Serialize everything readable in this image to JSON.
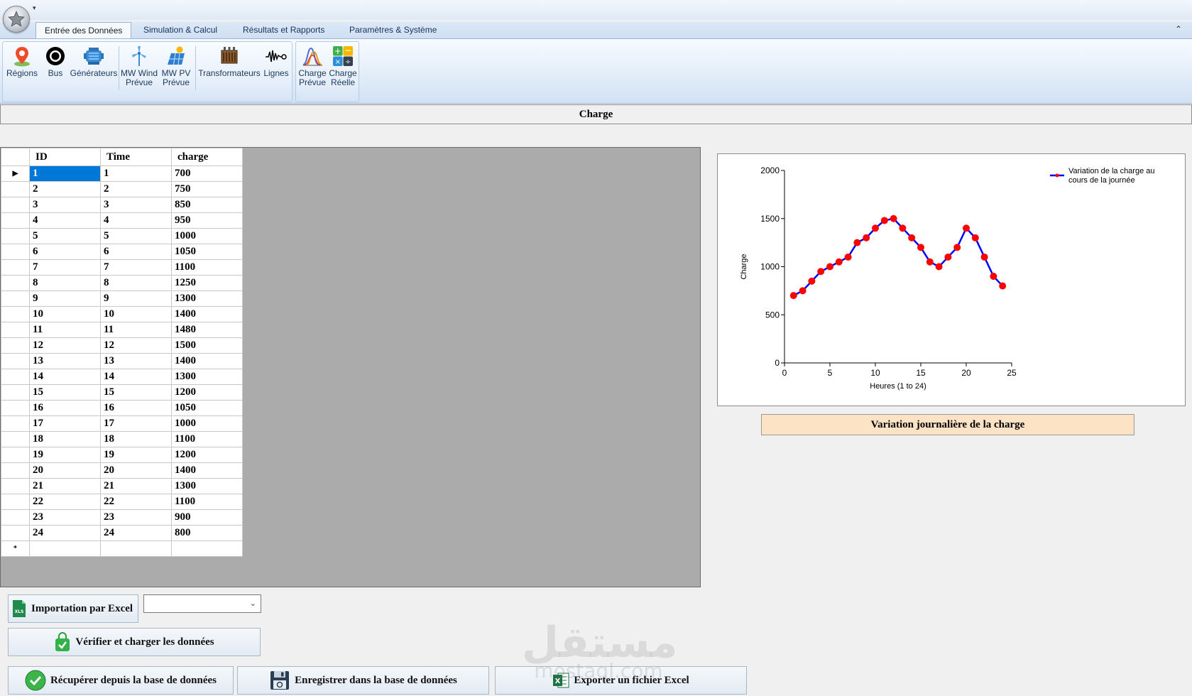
{
  "ribbon": {
    "tabs": [
      {
        "label": "Entrée des Données"
      },
      {
        "label": "Simulation & Calcul"
      },
      {
        "label": "Résultats et Rapports"
      },
      {
        "label": "Paramètres & Système"
      }
    ],
    "buttons": [
      {
        "line1": "Régions",
        "line2": "",
        "icon": "map-pin-icon"
      },
      {
        "line1": "Bus",
        "line2": "",
        "icon": "bus-ring-icon"
      },
      {
        "line1": "Générateurs",
        "line2": "",
        "icon": "generator-icon"
      },
      {
        "line1": "MW Wind",
        "line2": "Prévue",
        "icon": "wind-turbine-icon"
      },
      {
        "line1": "MW PV",
        "line2": "Prévue",
        "icon": "solar-panel-icon"
      },
      {
        "line1": "Transformateurs",
        "line2": "",
        "icon": "transformer-icon"
      },
      {
        "line1": "Lignes",
        "line2": "",
        "icon": "line-wave-icon"
      },
      {
        "line1": "Charge",
        "line2": "Prévue",
        "icon": "load-curve-icon"
      },
      {
        "line1": "Charge",
        "line2": "Réelle",
        "icon": "calculator-icon"
      }
    ]
  },
  "section": {
    "title": "Charge"
  },
  "grid": {
    "columns": [
      "ID",
      "Time",
      "charge"
    ],
    "rows": [
      [
        "1",
        "1",
        "700"
      ],
      [
        "2",
        "2",
        "750"
      ],
      [
        "3",
        "3",
        "850"
      ],
      [
        "4",
        "4",
        "950"
      ],
      [
        "5",
        "5",
        "1000"
      ],
      [
        "6",
        "6",
        "1050"
      ],
      [
        "7",
        "7",
        "1100"
      ],
      [
        "8",
        "8",
        "1250"
      ],
      [
        "9",
        "9",
        "1300"
      ],
      [
        "10",
        "10",
        "1400"
      ],
      [
        "11",
        "11",
        "1480"
      ],
      [
        "12",
        "12",
        "1500"
      ],
      [
        "13",
        "13",
        "1400"
      ],
      [
        "14",
        "14",
        "1300"
      ],
      [
        "15",
        "15",
        "1200"
      ],
      [
        "16",
        "16",
        "1050"
      ],
      [
        "17",
        "17",
        "1000"
      ],
      [
        "18",
        "18",
        "1100"
      ],
      [
        "19",
        "19",
        "1200"
      ],
      [
        "20",
        "20",
        "1400"
      ],
      [
        "21",
        "21",
        "1300"
      ],
      [
        "22",
        "22",
        "1100"
      ],
      [
        "23",
        "23",
        "900"
      ],
      [
        "24",
        "24",
        "800"
      ]
    ],
    "current_row_marker": "▶",
    "new_row_marker": "*"
  },
  "chart_data": {
    "type": "line",
    "title": "",
    "xlabel": "Heures (1 to 24)",
    "ylabel": "Charge",
    "xlim": [
      0,
      25
    ],
    "ylim": [
      0,
      2000
    ],
    "xticks": [
      0,
      5,
      10,
      15,
      20,
      25
    ],
    "yticks": [
      0,
      500,
      1000,
      1500,
      2000
    ],
    "legend_position": "top-right",
    "grid": false,
    "series": [
      {
        "name": "Variation de la charge au cours de la journée",
        "legend_line1": "Variation de la charge au",
        "legend_line2": "cours de la journée",
        "line_color": "#0000ff",
        "marker_color": "#ff0000",
        "x": [
          1,
          2,
          3,
          4,
          5,
          6,
          7,
          8,
          9,
          10,
          11,
          12,
          13,
          14,
          15,
          16,
          17,
          18,
          19,
          20,
          21,
          22,
          23,
          24
        ],
        "y": [
          700,
          750,
          850,
          950,
          1000,
          1050,
          1100,
          1250,
          1300,
          1400,
          1480,
          1500,
          1400,
          1300,
          1200,
          1050,
          1000,
          1100,
          1200,
          1400,
          1300,
          1100,
          900,
          800
        ]
      }
    ]
  },
  "chart_caption": "Variation journalière de la charge",
  "actions": {
    "import_excel": "Importation par Excel",
    "excel_select_value": "",
    "verify_load": "Vérifier et charger les données",
    "fetch_db": "Récupérer depuis la base de données",
    "save_db": "Enregistrer dans la base de données",
    "export_excel": "Exporter un fichier Excel"
  },
  "watermark": {
    "text": "مستقل",
    "sub": "mostaql.com"
  },
  "colors": {
    "selection": "#0078d7",
    "caption_bg": "#fde3c6",
    "grid_bg": "#ababab"
  }
}
